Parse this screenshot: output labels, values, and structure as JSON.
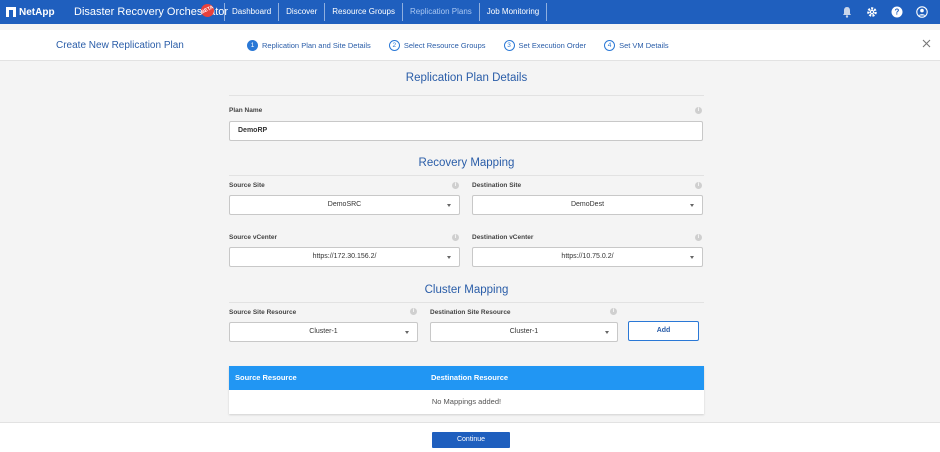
{
  "app": {
    "brand": "NetApp",
    "title": "Disaster Recovery Orchestrator",
    "badge": "BETA"
  },
  "nav": [
    {
      "label": "Dashboard"
    },
    {
      "label": "Discover"
    },
    {
      "label": "Resource Groups"
    },
    {
      "label": "Replication Plans"
    },
    {
      "label": "Job Monitoring"
    }
  ],
  "top_icons": [
    "bell-icon",
    "gear-icon",
    "help-icon",
    "user-icon"
  ],
  "wizard": {
    "title": "Create New Replication Plan",
    "steps": [
      {
        "num": "1",
        "label": "Replication Plan and Site Details"
      },
      {
        "num": "2",
        "label": "Select Resource Groups"
      },
      {
        "num": "3",
        "label": "Set Execution Order"
      },
      {
        "num": "4",
        "label": "Set VM Details"
      }
    ]
  },
  "form": {
    "heading": "Replication Plan Details",
    "plan_name_label": "Plan Name",
    "plan_name_value": "DemoRP",
    "recovery_heading": "Recovery Mapping",
    "source_site_label": "Source Site",
    "source_site_value": "DemoSRC",
    "dest_site_label": "Destination Site",
    "dest_site_value": "DemoDest",
    "source_vcenter_label": "Source vCenter",
    "source_vcenter_value": "https://172.30.156.2/",
    "dest_vcenter_label": "Destination vCenter",
    "dest_vcenter_value": "https://10.75.0.2/",
    "cluster_heading": "Cluster Mapping",
    "source_resource_label": "Source Site Resource",
    "source_resource_value": "Cluster-1",
    "dest_resource_label": "Destination Site Resource",
    "dest_resource_value": "Cluster-1",
    "add_label": "Add"
  },
  "mapping_table": {
    "columns": [
      "Source Resource",
      "Destination Resource"
    ],
    "empty_text": "No Mappings added!"
  },
  "footer": {
    "continue_label": "Continue"
  },
  "colors": {
    "topbar": "#1f5fbe",
    "accent": "#2a78d6",
    "table_header": "#2196f3"
  }
}
